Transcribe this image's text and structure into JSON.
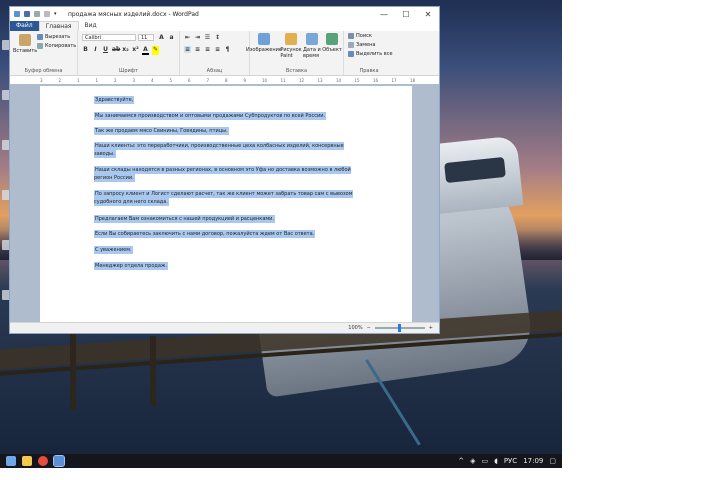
{
  "window": {
    "title": "продажа мясных изделий.docx - WordPad",
    "controls": {
      "minimize": "—",
      "maximize": "☐",
      "close": "✕"
    }
  },
  "tabs": {
    "file": "Файл",
    "home": "Главная",
    "view": "Вид"
  },
  "ribbon": {
    "clipboard": {
      "paste": "Вставить",
      "cut": "Вырезать",
      "copy": "Копировать",
      "label": "Буфер обмена"
    },
    "font": {
      "family": "Calibri",
      "size": "11",
      "label": "Шрифт"
    },
    "paragraph": {
      "label": "Абзац"
    },
    "insert": {
      "image": "Изображение",
      "paint": "Рисунок Paint",
      "datetime": "Дата и время",
      "object": "Объект",
      "label": "Вставка"
    },
    "editing": {
      "find": "Поиск",
      "replace": "Замена",
      "select_all": "Выделить все",
      "label": "Правка"
    }
  },
  "ruler": {
    "ticks": [
      "3",
      "2",
      "1",
      "1",
      "2",
      "3",
      "4",
      "5",
      "6",
      "7",
      "8",
      "9",
      "10",
      "11",
      "12",
      "13",
      "14",
      "15",
      "16",
      "17",
      "18"
    ]
  },
  "document": {
    "paragraphs": [
      "Здравствуйте,",
      "Мы занимаемся производством и оптовыми продажами Субпродуктов по всей России.",
      "Так же продаем мясо Свинины, Говядины, птицы.",
      "Наши клиенты: это переработчики, производственные цеха колбасных изделий, консервные заводы.",
      "Наши склады находятся в разных регионах, в основном это Уфа но доставка возможно в любой регион России.",
      "По запросу клиент и Логист сделают расчет, так же клиент может забрать товар сам с вывозом судобного для него склада.",
      "Предлагаем Вам ознакомиться с нашей продукцией и расценками.",
      "Если Вы собираетесь заключить с нами договор, пожалуйста ждем от Вас ответа.",
      " С уважением.",
      "Менеджер отдела продаж."
    ]
  },
  "status": {
    "zoom": "100%",
    "zoom_minus": "−",
    "zoom_plus": "+",
    "zoom_level": 0.5
  },
  "taskbar": {
    "lang": "РУС",
    "time": "17:09"
  },
  "colors": {
    "file_tab": "#2b5797",
    "selection": "#a9c8ef",
    "zoom_thumb": "#2b79d8"
  }
}
